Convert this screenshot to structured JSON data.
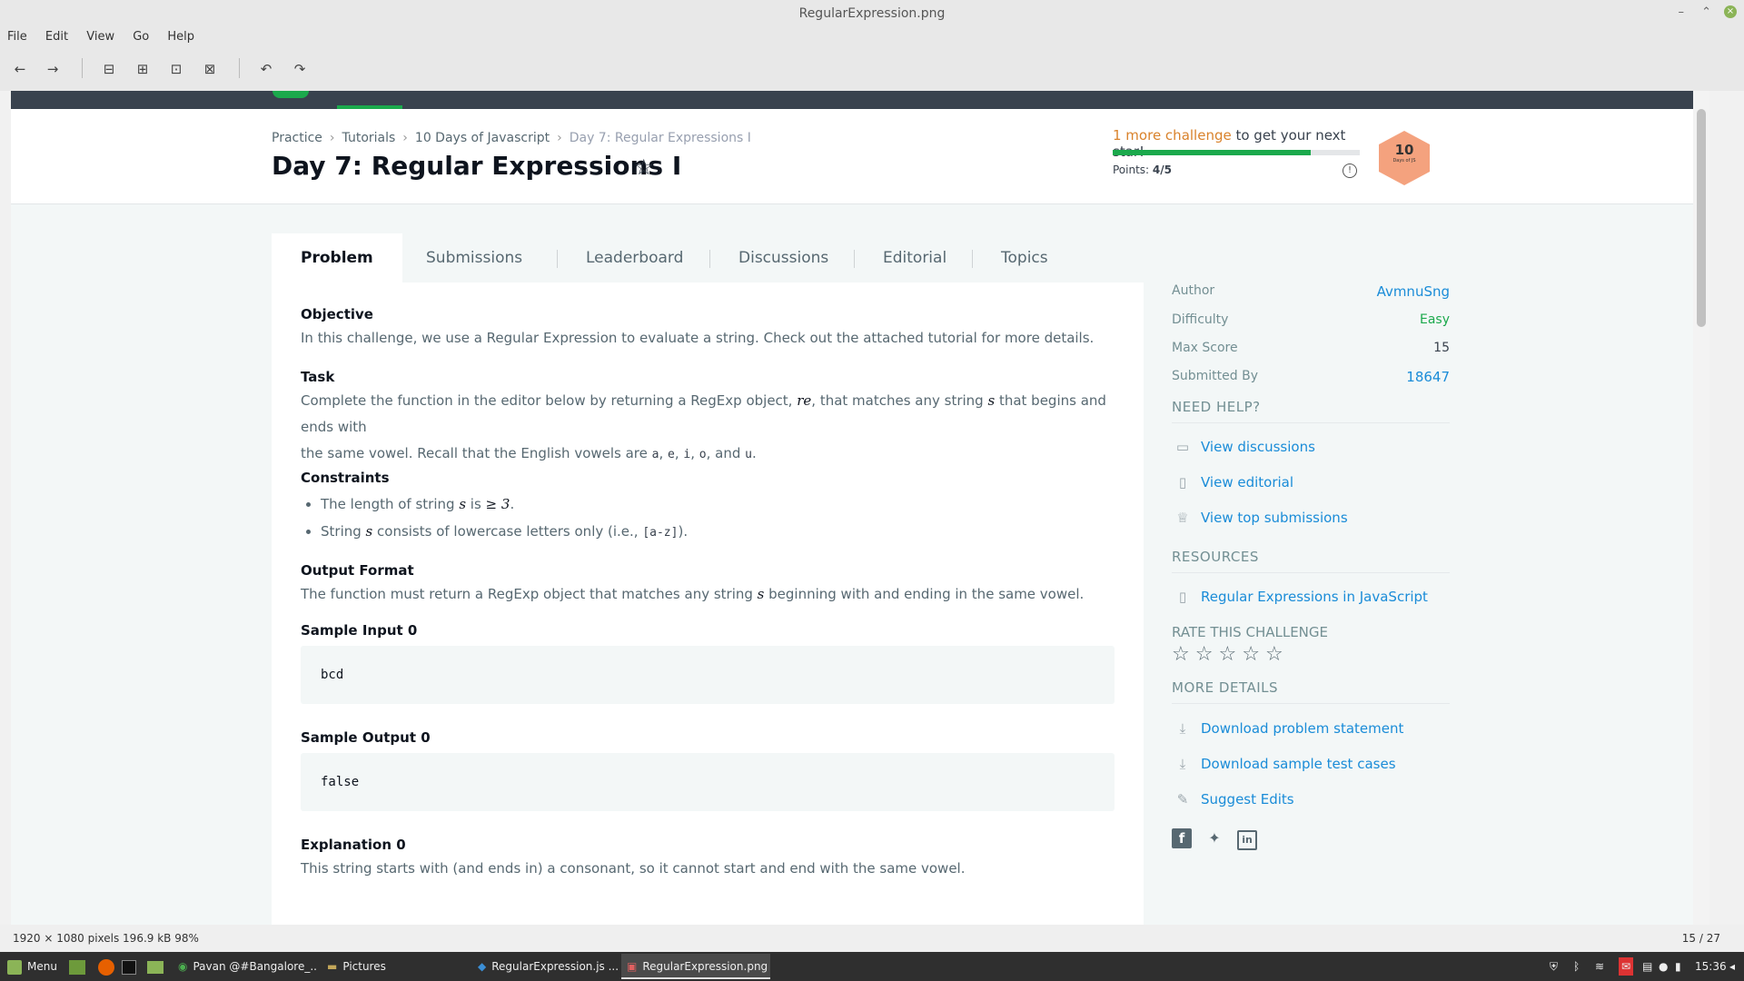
{
  "viewer": {
    "title": "RegularExpression.png",
    "menu": [
      "File",
      "Edit",
      "View",
      "Go",
      "Help"
    ],
    "status_left": "1920 × 1080 pixels  196.9 kB   98%",
    "status_right": "15 / 27"
  },
  "taskbar": {
    "menu_label": "Menu",
    "tasks": [
      "Pavan @#Bangalore_...",
      "Pictures",
      "RegularExpression.js ...",
      "RegularExpression.png"
    ],
    "clock": "15:36"
  },
  "page": {
    "breadcrumbs": [
      "Practice",
      "Tutorials",
      "10 Days of Javascript",
      "Day 7: Regular Expressions I"
    ],
    "title": "Day 7: Regular Expressions I",
    "promo_highlight": "1 more challenge",
    "promo_rest": " to get your next star!",
    "progress_fraction": 0.8,
    "points_label": "Points:",
    "points_value": "4/5",
    "badge_number": "10",
    "badge_label": "Days of JS",
    "tabs": [
      "Problem",
      "Submissions",
      "Leaderboard",
      "Discussions",
      "Editorial",
      "Topics"
    ]
  },
  "problem": {
    "objective_h": "Objective",
    "objective": "In this challenge, we use a Regular Expression to evaluate a string. Check out the attached tutorial for more details.",
    "task_h": "Task",
    "task_1": "Complete the function in the editor below by returning a RegExp object, ",
    "task_re": "re",
    "task_2": ", that matches any string ",
    "task_s": "s",
    "task_3": " that begins and ends with",
    "task_4": "the same vowel. Recall that the English vowels are ",
    "vowels": [
      "a",
      "e",
      "i",
      "o",
      "u"
    ],
    "task_5": ", and ",
    "constraints_h": "Constraints",
    "c1_a": "The length of string ",
    "c1_b": " is ",
    "c1_ge": "≥ 3",
    "c2_a": "String ",
    "c2_b": " consists of lowercase letters only (i.e., ",
    "c2_code": "[a-z]",
    "c2_c": ").",
    "output_h": "Output Format",
    "output_a": "The function must return a RegExp object that matches any string ",
    "output_b": " beginning with and ending in the same vowel.",
    "si0_h": "Sample Input 0",
    "si0": "bcd",
    "so0_h": "Sample Output 0",
    "so0": "false",
    "ex0_h": "Explanation 0",
    "ex0": "This string starts with (and ends in) a consonant, so it cannot start and end with the same vowel."
  },
  "sidebar": {
    "author_k": "Author",
    "author_v": "AvmnuSng",
    "difficulty_k": "Difficulty",
    "difficulty_v": "Easy",
    "maxscore_k": "Max Score",
    "maxscore_v": "15",
    "submitted_k": "Submitted By",
    "submitted_v": "18647",
    "need_help": "NEED HELP?",
    "help_links": [
      "View discussions",
      "View editorial",
      "View top submissions"
    ],
    "resources": "RESOURCES",
    "resource_link": "Regular Expressions in JavaScript",
    "rate": "RATE THIS CHALLENGE",
    "more": "MORE DETAILS",
    "more_links": [
      "Download problem statement",
      "Download sample test cases",
      "Suggest Edits"
    ]
  },
  "colors": {
    "accent": "#1a8cd8",
    "green": "#1ba94c",
    "orange": "#d9822b",
    "badge": "#f4a27e"
  }
}
